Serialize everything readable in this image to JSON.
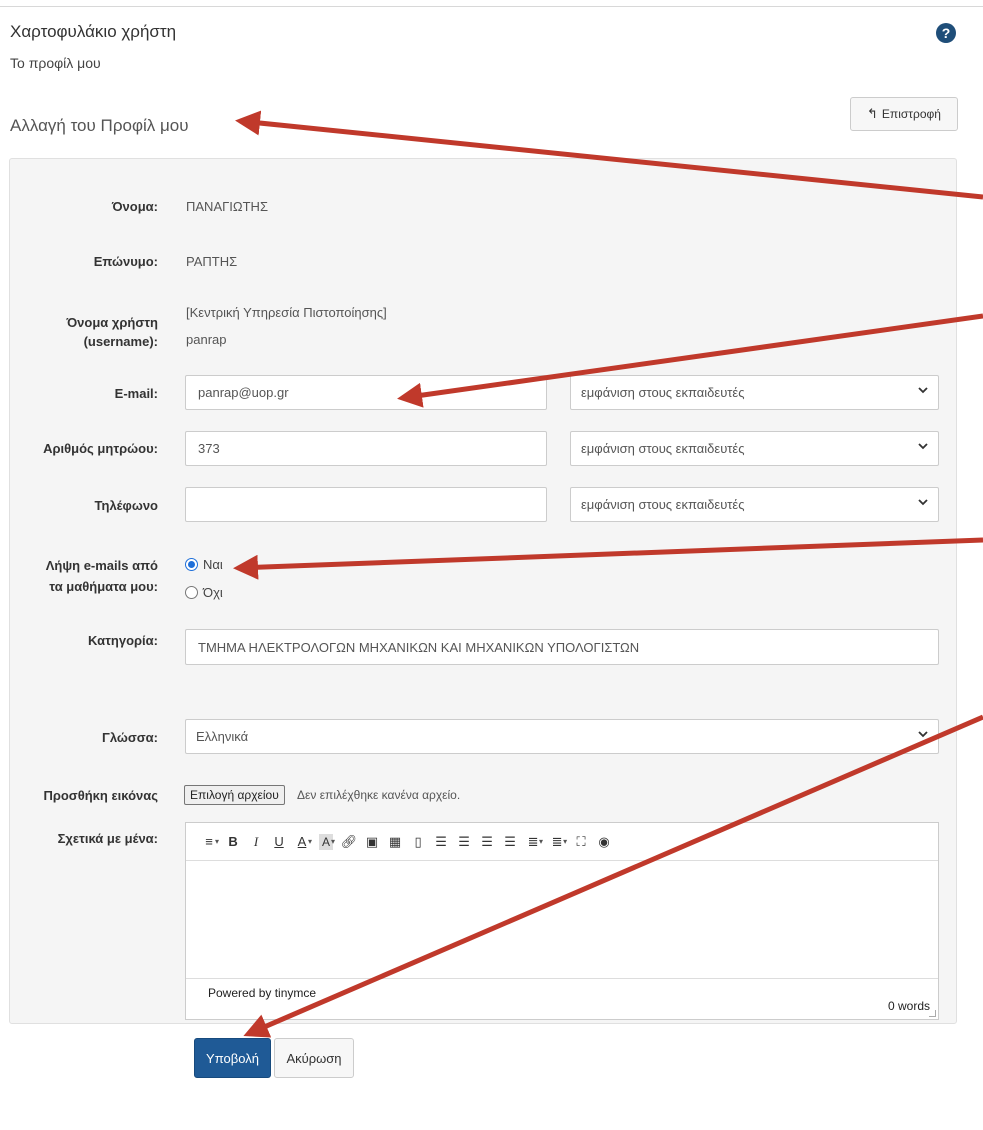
{
  "header": {
    "portfolio_title": "Χαρτοφυλάκιο χρήστη",
    "subtitle": "Το προφίλ μου",
    "help_icon": "?"
  },
  "section": {
    "title": "Αλλαγή του Προφίλ μου",
    "back_label": "Επιστροφή"
  },
  "form": {
    "name_label": "Όνομα:",
    "name_value": "ΠΑΝΑΓΙΩΤΗΣ",
    "surname_label": "Επώνυμο:",
    "surname_value": "ΡΑΠΤΗΣ",
    "username_label_1": "Όνομα χρήστη",
    "username_label_2": "(username):",
    "username_source": "[Κεντρική Υπηρεσία Πιστοποίησης]",
    "username_value": "panrap",
    "email_label": "E-mail:",
    "email_value": "panrap@uop.gr",
    "email_visibility": "εμφάνιση στους εκπαιδευτές",
    "am_label": "Αριθμός μητρώου:",
    "am_value": "373",
    "am_visibility": "εμφάνιση στους εκπαιδευτές",
    "phone_label": "Τηλέφωνο",
    "phone_value": "",
    "phone_visibility": "εμφάνιση στους εκπαιδευτές",
    "emails_label_1": "Λήψη e-mails από",
    "emails_label_2": "τα μαθήματα μου:",
    "emails_yes": "Ναι",
    "emails_no": "Όχι",
    "category_label": "Κατηγορία:",
    "category_value": "ΤΜΗΜΑ ΗΛΕΚΤΡΟΛΟΓΩΝ ΜΗΧΑΝΙΚΩΝ ΚΑΙ ΜΗΧΑΝΙΚΩΝ ΥΠΟΛΟΓΙΣΤΩΝ",
    "language_label": "Γλώσσα:",
    "language_value": "Ελληνικά",
    "image_label": "Προσθήκη εικόνας",
    "file_button": "Επιλογή αρχείου",
    "file_status": "Δεν επιλέχθηκε κανένα αρχείο.",
    "about_label": "Σχετικά με μένα:",
    "submit_label": "Υποβολή",
    "cancel_label": "Ακύρωση"
  },
  "editor": {
    "bold": "B",
    "italic": "I",
    "underline": "U",
    "font_color": "A",
    "bg_color": "A",
    "powered": "Powered by tinymce",
    "words": "0 words"
  },
  "annotation_color": "#c0392b"
}
